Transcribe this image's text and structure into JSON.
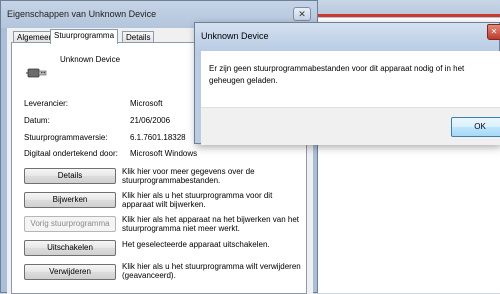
{
  "properties_window": {
    "title": "Eigenschappen van Unknown Device",
    "close_label": "✕",
    "tabs": [
      {
        "label": "Algemeen"
      },
      {
        "label": "Stuurprogramma"
      },
      {
        "label": "Details"
      }
    ],
    "device_name": "Unknown Device",
    "info": [
      {
        "label": "Leverancier:",
        "value": "Microsoft"
      },
      {
        "label": "Datum:",
        "value": "21/06/2006"
      },
      {
        "label": "Stuurprogrammaversie:",
        "value": "6.1.7601.18328"
      },
      {
        "label": "Digitaal ondertekend door:",
        "value": "Microsoft Windows"
      }
    ],
    "actions": [
      {
        "label": "Details",
        "description": "Klik hier voor meer gegevens over de stuurprogrammabestanden.",
        "disabled": false
      },
      {
        "label": "Bijwerken",
        "description": "Klik hier als u het stuurprogramma voor dit apparaat wilt bijwerken.",
        "disabled": false
      },
      {
        "label": "Vorig stuurprogramma",
        "description": "Klik hier als het apparaat na het bijwerken van het stuurprogramma niet meer werkt.",
        "disabled": true
      },
      {
        "label": "Uitschakelen",
        "description": "Het geselecteerde apparaat uitschakelen.",
        "disabled": false
      },
      {
        "label": "Verwijderen",
        "description": "Klik hier als u het stuurprogramma wilt verwijderen (geavanceerd).",
        "disabled": false
      }
    ]
  },
  "dialog": {
    "title": "Unknown Device",
    "close_label": "✕",
    "message": "Er zijn geen stuurprogrammabestanden voor dit apparaat nodig of in het geheugen geladen.",
    "ok_label": "OK"
  }
}
